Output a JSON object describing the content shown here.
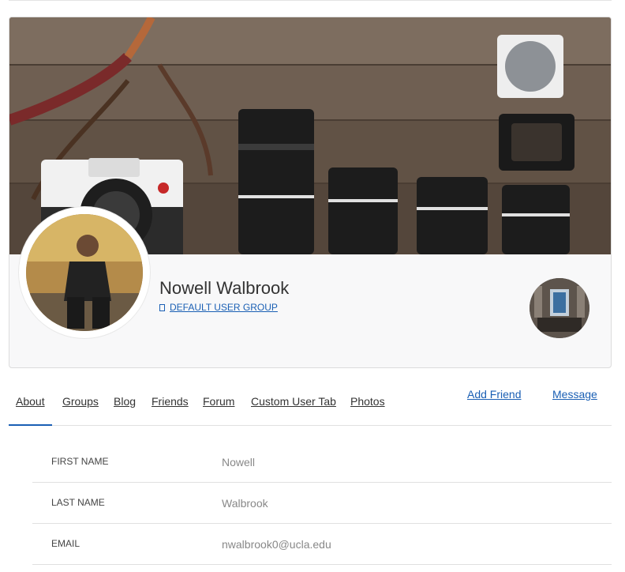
{
  "profile": {
    "name": "Nowell Walbrook",
    "group_label": "DEFAULT USER GROUP"
  },
  "tabs": [
    {
      "label": "About",
      "active": true
    },
    {
      "label": "Groups",
      "active": false
    },
    {
      "label": "Blog",
      "active": false
    },
    {
      "label": "Friends",
      "active": false
    },
    {
      "label": "Forum",
      "active": false
    },
    {
      "label": "Custom User Tab",
      "active": false
    },
    {
      "label": "Photos",
      "active": false
    }
  ],
  "actions": {
    "add_friend": "Add Friend",
    "message": "Message"
  },
  "about": {
    "fields": [
      {
        "label": "FIRST NAME",
        "value": "Nowell"
      },
      {
        "label": "LAST NAME",
        "value": "Walbrook"
      },
      {
        "label": "EMAIL",
        "value": "nwalbrook0@ucla.edu"
      }
    ]
  },
  "colors": {
    "link": "#1a5fb4",
    "border": "#e0e0e0",
    "card_background": "#f8f8f9"
  },
  "icons": {
    "group_icon": "document-icon"
  }
}
